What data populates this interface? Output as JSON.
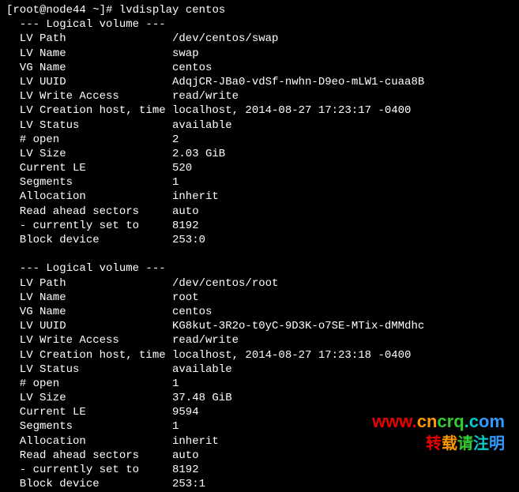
{
  "prompt": "[root@node44 ~]# lvdisplay centos",
  "volumes": [
    {
      "header": "  --- Logical volume ---",
      "fields": [
        {
          "label": "  LV Path",
          "value": "/dev/centos/swap"
        },
        {
          "label": "  LV Name",
          "value": "swap"
        },
        {
          "label": "  VG Name",
          "value": "centos"
        },
        {
          "label": "  LV UUID",
          "value": "AdqjCR-JBa0-vdSf-nwhn-D9eo-mLW1-cuaa8B"
        },
        {
          "label": "  LV Write Access",
          "value": "read/write"
        },
        {
          "label": "  LV Creation host, time",
          "value": "localhost, 2014-08-27 17:23:17 -0400"
        },
        {
          "label": "  LV Status",
          "value": "available"
        },
        {
          "label": "  # open",
          "value": "2"
        },
        {
          "label": "  LV Size",
          "value": "2.03 GiB"
        },
        {
          "label": "  Current LE",
          "value": "520"
        },
        {
          "label": "  Segments",
          "value": "1"
        },
        {
          "label": "  Allocation",
          "value": "inherit"
        },
        {
          "label": "  Read ahead sectors",
          "value": "auto"
        },
        {
          "label": "  - currently set to",
          "value": "8192"
        },
        {
          "label": "  Block device",
          "value": "253:0"
        }
      ]
    },
    {
      "header": "  --- Logical volume ---",
      "fields": [
        {
          "label": "  LV Path",
          "value": "/dev/centos/root"
        },
        {
          "label": "  LV Name",
          "value": "root"
        },
        {
          "label": "  VG Name",
          "value": "centos"
        },
        {
          "label": "  LV UUID",
          "value": "KG8kut-3R2o-t0yC-9D3K-o7SE-MTix-dMMdhc"
        },
        {
          "label": "  LV Write Access",
          "value": "read/write"
        },
        {
          "label": "  LV Creation host, time",
          "value": "localhost, 2014-08-27 17:23:18 -0400"
        },
        {
          "label": "  LV Status",
          "value": "available"
        },
        {
          "label": "  # open",
          "value": "1"
        },
        {
          "label": "  LV Size",
          "value": "37.48 GiB"
        },
        {
          "label": "  Current LE",
          "value": "9594"
        },
        {
          "label": "  Segments",
          "value": "1"
        },
        {
          "label": "  Allocation",
          "value": "inherit"
        },
        {
          "label": "  Read ahead sectors",
          "value": "auto"
        },
        {
          "label": "  - currently set to",
          "value": "8192"
        },
        {
          "label": "  Block device",
          "value": "253:1"
        }
      ]
    }
  ],
  "watermark": {
    "line1_parts": [
      "www.",
      "cn",
      "crq",
      ".c",
      "om"
    ],
    "line2_parts": [
      "转",
      "载",
      "请",
      "注",
      "明"
    ]
  }
}
